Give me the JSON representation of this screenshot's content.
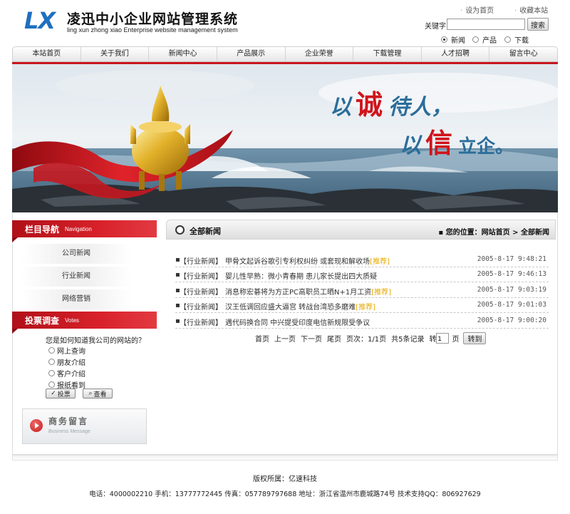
{
  "header": {
    "logo_mark": "LX",
    "logo_cn": "凌迅中小企业网站管理系统",
    "logo_en": "ling xun zhong xiao Enterprise website management system",
    "set_home": "设为首页",
    "bookmark": "收藏本站",
    "search_label": "关键字：",
    "search_value": "",
    "search_button": "搜索",
    "search_scopes": [
      {
        "label": "新闻",
        "checked": true
      },
      {
        "label": "产品",
        "checked": false
      },
      {
        "label": "下载",
        "checked": false
      }
    ]
  },
  "nav": [
    "本站首页",
    "关于我们",
    "新闻中心",
    "产品展示",
    "企业荣誉",
    "下载管理",
    "人才招聘",
    "留言中心"
  ],
  "banner": {
    "slogan_1a": "以",
    "slogan_1b": "诚",
    "slogan_1c": "待人，",
    "slogan_2a": "以",
    "slogan_2b": "信",
    "slogan_2c": "立企。"
  },
  "sidebar": {
    "nav_title": "栏目导航",
    "nav_title_en": "Navigation",
    "nav_items": [
      "公司新闻",
      "行业新闻",
      "网络营销"
    ],
    "vote_title": "投票调查",
    "vote_title_en": "Votes",
    "vote_question": "您是如何知道我公司的网站的？",
    "vote_options": [
      "网上查询",
      "朋友介绍",
      "客户介绍",
      "报纸看到"
    ],
    "vote_button": "投票",
    "view_button": "查看",
    "message_cn": "商务留言",
    "message_en": "Business Message"
  },
  "main": {
    "title": "全部新闻",
    "crumb_prefix": "您的位置：",
    "crumb_home": "网站首页",
    "crumb_sep": ">",
    "crumb_current": "全部新闻",
    "news": [
      {
        "cat": "【行业新闻】",
        "title": "甲骨文起诉谷歌引专利权纠纷 或套现和解收场",
        "rec": "[推荐]",
        "date": "2005-8-17 9:48:21"
      },
      {
        "cat": "【行业新闻】",
        "title": "婴儿性早熟：微小青春期 患儿家长提出四大质疑",
        "rec": "",
        "date": "2005-8-17 9:46:13"
      },
      {
        "cat": "【行业新闻】",
        "title": "消息称宏碁将为方正PC高职员工晒N+1月工资",
        "rec": "[推荐]",
        "date": "2005-8-17 9:03:19"
      },
      {
        "cat": "【行业新闻】",
        "title": "汉王低调回应盛大逼宫 转战台湾恐多磨难",
        "rec": "[推荐]",
        "date": "2005-8-17 9:01:03"
      },
      {
        "cat": "【行业新闻】",
        "title": "遇代码换合同 中兴提受印度电信新规限受争议",
        "rec": "",
        "date": "2005-8-17 9:00:20"
      }
    ],
    "pager": {
      "first": "首页",
      "prev": "上一页",
      "next": "下一页",
      "last": "尾页",
      "pages": "页次：1/1页",
      "total": "共5条记录",
      "goto_prefix": "转",
      "page_value": "1",
      "goto_suffix": "页",
      "goto_button": "转到"
    }
  },
  "footer": {
    "copyright": "版权所属：亿速科技",
    "contact": "电话：4000002210 手机：13777772445 传真：057789797688 地址：浙江省温州市鹿城路74号 技术支持QQ：806927629"
  },
  "colors": {
    "brand_red": "#c8161d",
    "logo_blue": "#1f6fc0",
    "recommend": "#e6a800"
  }
}
